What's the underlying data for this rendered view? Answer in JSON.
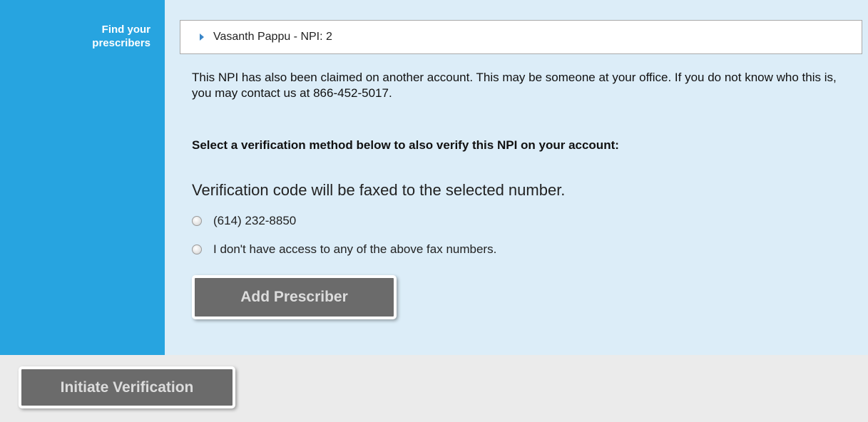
{
  "sidebar": {
    "label": "Find your prescribers"
  },
  "prescriber": {
    "name": "Vasanth Pappu - NPI: 2"
  },
  "notice": "This NPI has also been claimed on another account. This may be someone at your office. If you do not know who this is, you may contact us at 866-452-5017.",
  "instruction": "Select a verification method below to also verify this NPI on your account:",
  "fax_note": "Verification code will be faxed to the selected number.",
  "options": [
    {
      "label": "(614) 232-8850"
    },
    {
      "label": "I don't have access to any of the above fax numbers."
    }
  ],
  "buttons": {
    "add_prescriber": "Add Prescriber",
    "initiate_verification": "Initiate Verification"
  },
  "colors": {
    "sidebar": "#27a4e0",
    "panel": "#dcedf8",
    "footer": "#ebebeb",
    "button": "#6b6b6b"
  }
}
